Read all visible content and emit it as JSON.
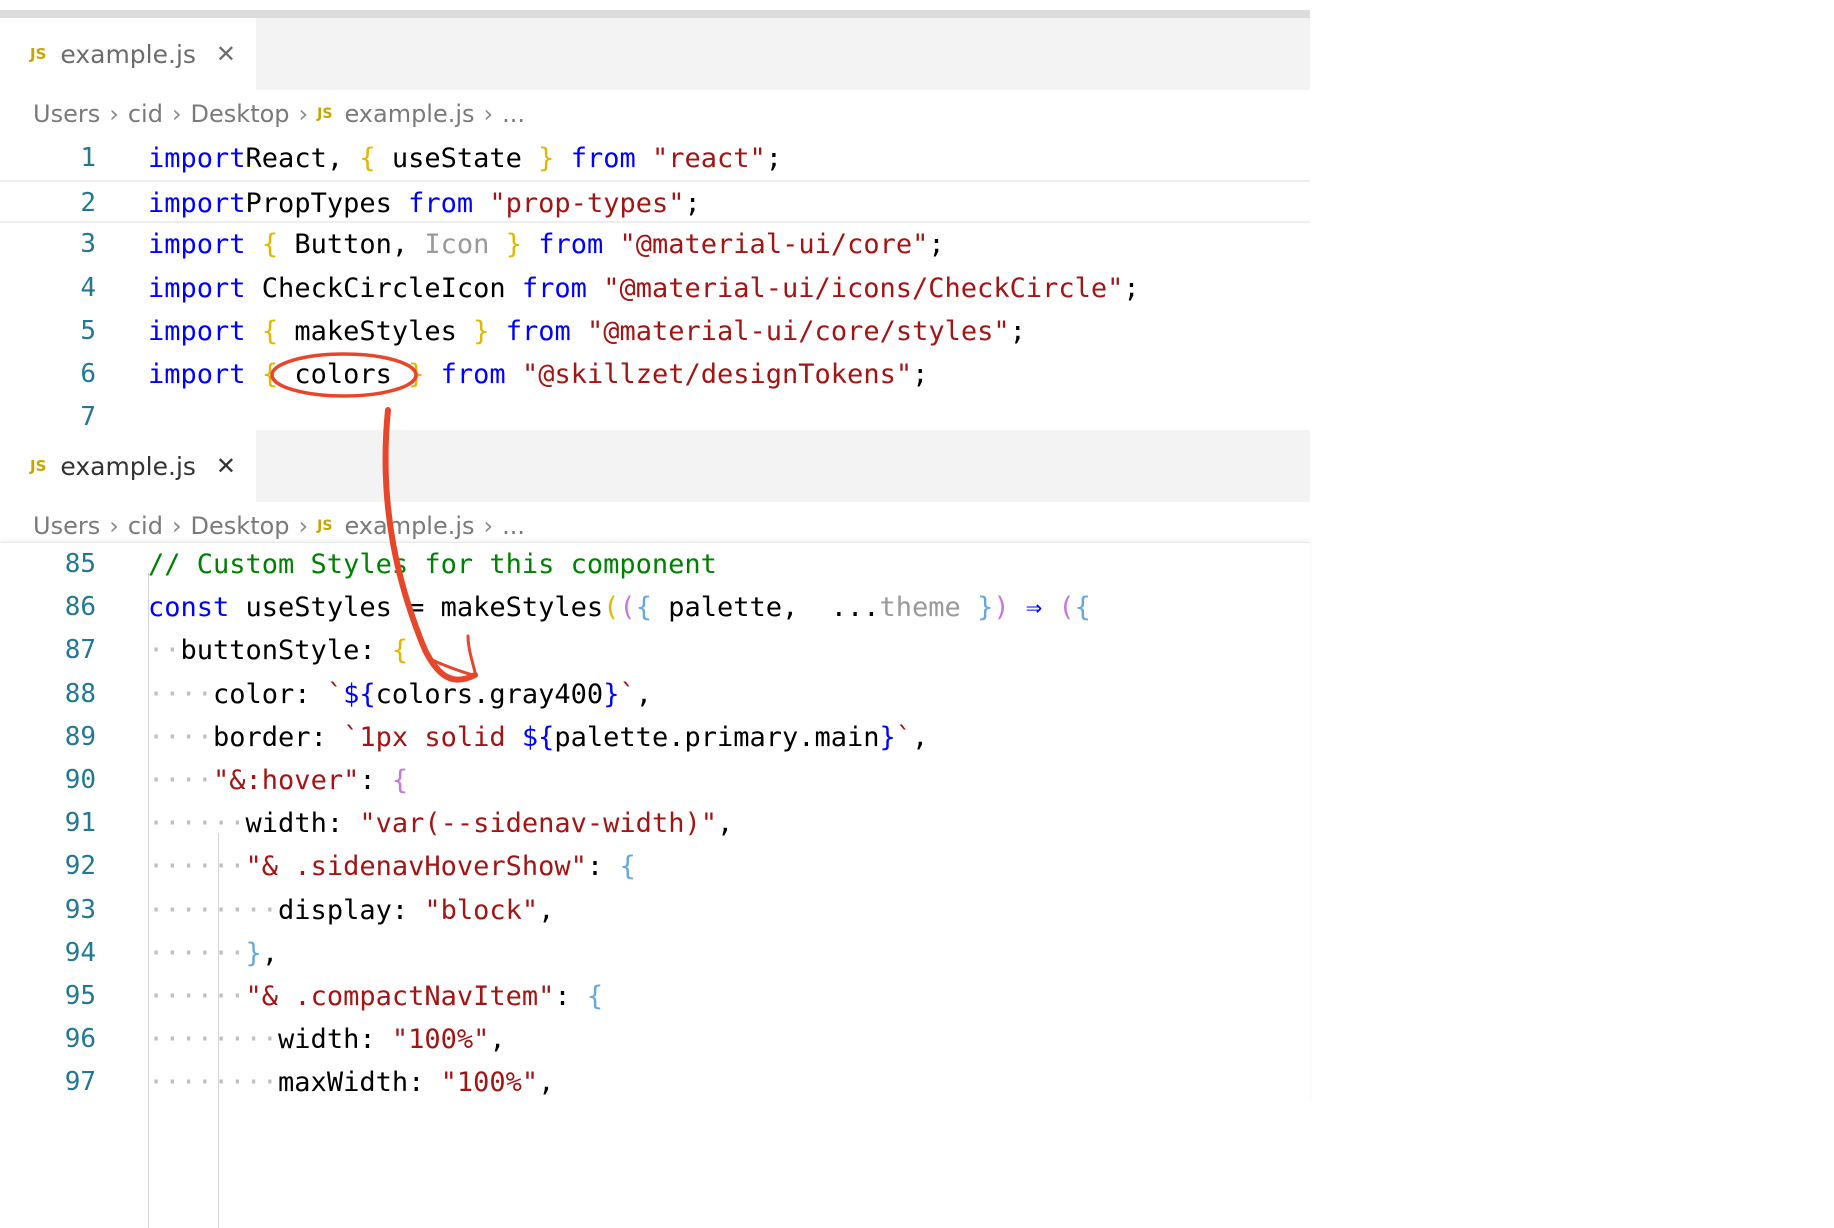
{
  "pane_top": {
    "tab": {
      "label": "example.js",
      "icon": "JS"
    },
    "breadcrumb": [
      "Users",
      "cid",
      "Desktop",
      "example.js",
      "..."
    ],
    "lines": [
      {
        "n": "1",
        "t": [
          [
            "kw",
            "import"
          ],
          [
            "",
            "React, "
          ],
          [
            "brc",
            "{"
          ],
          [
            "",
            " useState "
          ],
          [
            "brc",
            "}"
          ],
          [
            "",
            " "
          ],
          [
            "kw",
            "from"
          ],
          [
            "",
            " "
          ],
          [
            "str",
            "\"react\""
          ],
          [
            "",
            ";"
          ]
        ]
      },
      {
        "n": "2",
        "cur": true,
        "t": [
          [
            "kw",
            "import"
          ],
          [
            "",
            "PropTypes "
          ],
          [
            "kw",
            "from"
          ],
          [
            "",
            " "
          ],
          [
            "str",
            "\"prop-types\""
          ],
          [
            "",
            ";"
          ]
        ]
      },
      {
        "n": "3",
        "t": [
          [
            "kw",
            "import"
          ],
          [
            "",
            " "
          ],
          [
            "brc",
            "{"
          ],
          [
            "",
            " Button, "
          ],
          [
            "hint",
            "Icon"
          ],
          [
            "",
            " "
          ],
          [
            "brc",
            "}"
          ],
          [
            "",
            " "
          ],
          [
            "kw",
            "from"
          ],
          [
            "",
            " "
          ],
          [
            "str",
            "\"@material-ui/core\""
          ],
          [
            "",
            ";"
          ]
        ]
      },
      {
        "n": "4",
        "t": [
          [
            "kw",
            "import"
          ],
          [
            "",
            " CheckCircleIcon "
          ],
          [
            "kw",
            "from"
          ],
          [
            "",
            " "
          ],
          [
            "str",
            "\"@material-ui/icons/CheckCircle\""
          ],
          [
            "",
            ";"
          ]
        ]
      },
      {
        "n": "5",
        "t": [
          [
            "kw",
            "import"
          ],
          [
            "",
            " "
          ],
          [
            "brc",
            "{"
          ],
          [
            "",
            " makeStyles "
          ],
          [
            "brc",
            "}"
          ],
          [
            "",
            " "
          ],
          [
            "kw",
            "from"
          ],
          [
            "",
            " "
          ],
          [
            "str",
            "\"@material-ui/core/styles\""
          ],
          [
            "",
            ";"
          ]
        ]
      },
      {
        "n": "6",
        "t": [
          [
            "kw",
            "import"
          ],
          [
            "",
            " "
          ],
          [
            "brc",
            "{"
          ],
          [
            "",
            " colors "
          ],
          [
            "brc",
            "}"
          ],
          [
            "",
            " "
          ],
          [
            "kw",
            "from"
          ],
          [
            "",
            " "
          ],
          [
            "str",
            "\"@skillzet/designTokens\""
          ],
          [
            "",
            ";"
          ]
        ]
      },
      {
        "n": "7",
        "t": []
      }
    ]
  },
  "pane_bottom": {
    "tab": {
      "label": "example.js",
      "icon": "JS"
    },
    "breadcrumb": [
      "Users",
      "cid",
      "Desktop",
      "example.js",
      "..."
    ],
    "lines": [
      {
        "n": "85",
        "t": [
          [
            "cm",
            "// Custom Styles for this component"
          ]
        ]
      },
      {
        "n": "86",
        "t": [
          [
            "kw",
            "const"
          ],
          [
            "",
            " useStyles = makeStyles"
          ],
          [
            "brc",
            "("
          ],
          [
            "brp",
            "("
          ],
          [
            "brb",
            "{"
          ],
          [
            "",
            " palette,  ..."
          ],
          [
            "hint",
            "theme"
          ],
          [
            "",
            " "
          ],
          [
            "brb",
            "}"
          ],
          [
            "brp",
            ")"
          ],
          [
            "",
            " "
          ],
          [
            "kw",
            "⇒"
          ],
          [
            "",
            " "
          ],
          [
            "brp",
            "("
          ],
          [
            "brb",
            "{"
          ]
        ]
      },
      {
        "n": "87",
        "t": [
          [
            "ws",
            "··"
          ],
          [
            "",
            "buttonStyle: "
          ],
          [
            "brc",
            "{"
          ]
        ]
      },
      {
        "n": "88",
        "t": [
          [
            "ws",
            "····"
          ],
          [
            "",
            "color: "
          ],
          [
            "str",
            "`"
          ],
          [
            "kw",
            "${"
          ],
          [
            "",
            "colors.gray400"
          ],
          [
            "kw",
            "}"
          ],
          [
            "str",
            "`"
          ],
          [
            "",
            ","
          ]
        ]
      },
      {
        "n": "89",
        "t": [
          [
            "ws",
            "····"
          ],
          [
            "",
            "border: "
          ],
          [
            "str",
            "`1px solid "
          ],
          [
            "kw",
            "${"
          ],
          [
            "",
            "palette.primary.main"
          ],
          [
            "kw",
            "}"
          ],
          [
            "str",
            "`"
          ],
          [
            "",
            ","
          ]
        ]
      },
      {
        "n": "90",
        "t": [
          [
            "ws",
            "····"
          ],
          [
            "str",
            "\"&:hover\""
          ],
          [
            "",
            ": "
          ],
          [
            "brp",
            "{"
          ]
        ]
      },
      {
        "n": "91",
        "t": [
          [
            "ws",
            "······"
          ],
          [
            "",
            "width: "
          ],
          [
            "str",
            "\"var(--sidenav-width)\""
          ],
          [
            "",
            ","
          ]
        ]
      },
      {
        "n": "92",
        "t": [
          [
            "ws",
            "······"
          ],
          [
            "str",
            "\"& .sidenavHoverShow\""
          ],
          [
            "",
            ": "
          ],
          [
            "brb",
            "{"
          ]
        ]
      },
      {
        "n": "93",
        "t": [
          [
            "ws",
            "········"
          ],
          [
            "",
            "display: "
          ],
          [
            "str",
            "\"block\""
          ],
          [
            "",
            ","
          ]
        ]
      },
      {
        "n": "94",
        "t": [
          [
            "ws",
            "······"
          ],
          [
            "brb",
            "}"
          ],
          [
            "",
            ","
          ]
        ]
      },
      {
        "n": "95",
        "t": [
          [
            "ws",
            "······"
          ],
          [
            "str",
            "\"& .compactNavItem\""
          ],
          [
            "",
            ": "
          ],
          [
            "brb",
            "{"
          ]
        ]
      },
      {
        "n": "96",
        "t": [
          [
            "ws",
            "········"
          ],
          [
            "",
            "width: "
          ],
          [
            "str",
            "\"100%\""
          ],
          [
            "",
            ","
          ]
        ]
      },
      {
        "n": "97",
        "t": [
          [
            "ws",
            "········"
          ],
          [
            "",
            "maxWidth: "
          ],
          [
            "str",
            "\"100%\""
          ],
          [
            "",
            ","
          ]
        ]
      }
    ]
  },
  "annotation_color": "#e8462a"
}
